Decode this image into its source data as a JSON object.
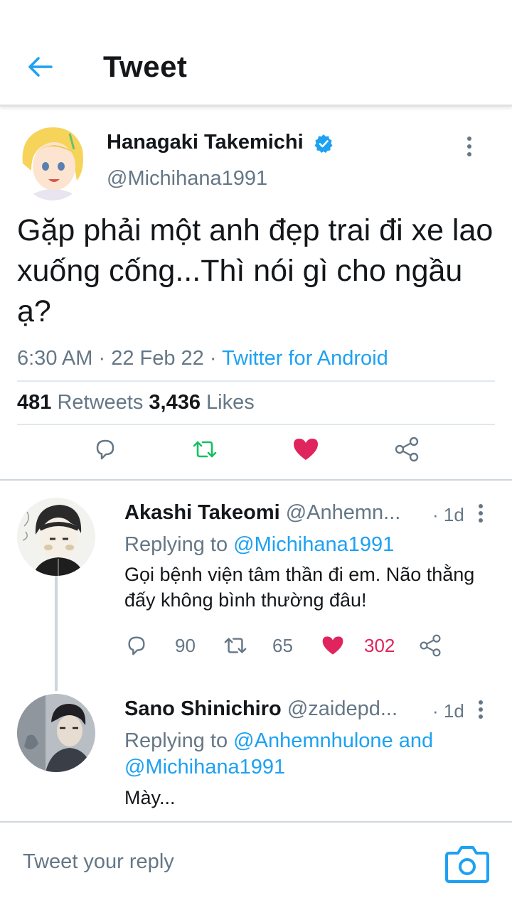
{
  "header": {
    "title": "Tweet"
  },
  "tweet": {
    "author_name": "Hanagaki Takemichi",
    "handle": "@Michihana1991",
    "text": "Gặp phải một anh đẹp trai đi xe lao xuống cống...Thì nói gì cho ngầu ạ?",
    "time": "6:30 AM",
    "separator": " · ",
    "date": "22 Feb 22",
    "source": "Twitter for Android",
    "retweets": "481",
    "retweets_label": " Retweets ",
    "likes": "3,436",
    "likes_label": " Likes",
    "liked": true
  },
  "replies": [
    {
      "name": "Akashi Takeomi",
      "handle": "@Anhemn...",
      "time": "· 1d",
      "replying_prefix": "Replying to ",
      "replying_to": "@Michihana1991",
      "text": "Gọi bệnh viện tâm thần đi em. Não thằng đấy không bình thường đâu!",
      "reply_count": "90",
      "retweet_count": "65",
      "like_count": "302",
      "liked": true
    },
    {
      "name": "Sano Shinichiro",
      "handle": "@zaidepd...",
      "time": "· 1d",
      "replying_prefix": "Replying to ",
      "replying_to": "@Anhemnhulone and @Michihana1991",
      "text": "Mày..."
    }
  ],
  "reply_bar": {
    "placeholder": "Tweet your reply"
  },
  "colors": {
    "accent": "#1da1f2",
    "like": "#e0245e",
    "retweet": "#17bf63",
    "muted": "#657786"
  },
  "icons": [
    "back-arrow-icon",
    "verified-badge-icon",
    "more-icon",
    "reply-icon",
    "retweet-icon",
    "heart-icon",
    "share-icon",
    "camera-icon"
  ]
}
